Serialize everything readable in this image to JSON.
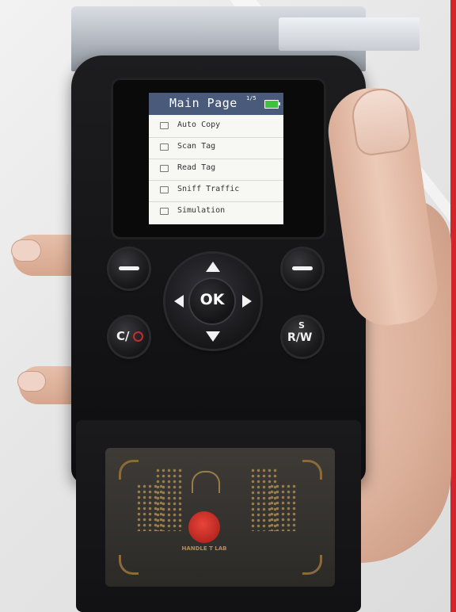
{
  "device_screen": {
    "title": "Main Page",
    "page_indicator": "1/5",
    "menu_items": [
      {
        "label": "Auto Copy",
        "icon": "copy-icon"
      },
      {
        "label": "Scan Tag",
        "icon": "scan-icon"
      },
      {
        "label": "Read Tag",
        "icon": "read-icon"
      },
      {
        "label": "Sniff Traffic",
        "icon": "sniff-icon"
      },
      {
        "label": "Simulation",
        "icon": "simulation-icon"
      }
    ],
    "header_color": "#4a5a7a",
    "battery_color": "#3ec33e"
  },
  "keypad": {
    "ok_label": "OK",
    "clear_label": "C/",
    "rw_top_label": "S",
    "rw_label": "R/W"
  },
  "reader_pad": {
    "logo_text": "HANDLE T LAB"
  },
  "colors": {
    "accent_red": "#d5232c",
    "device_body": "#141416"
  }
}
